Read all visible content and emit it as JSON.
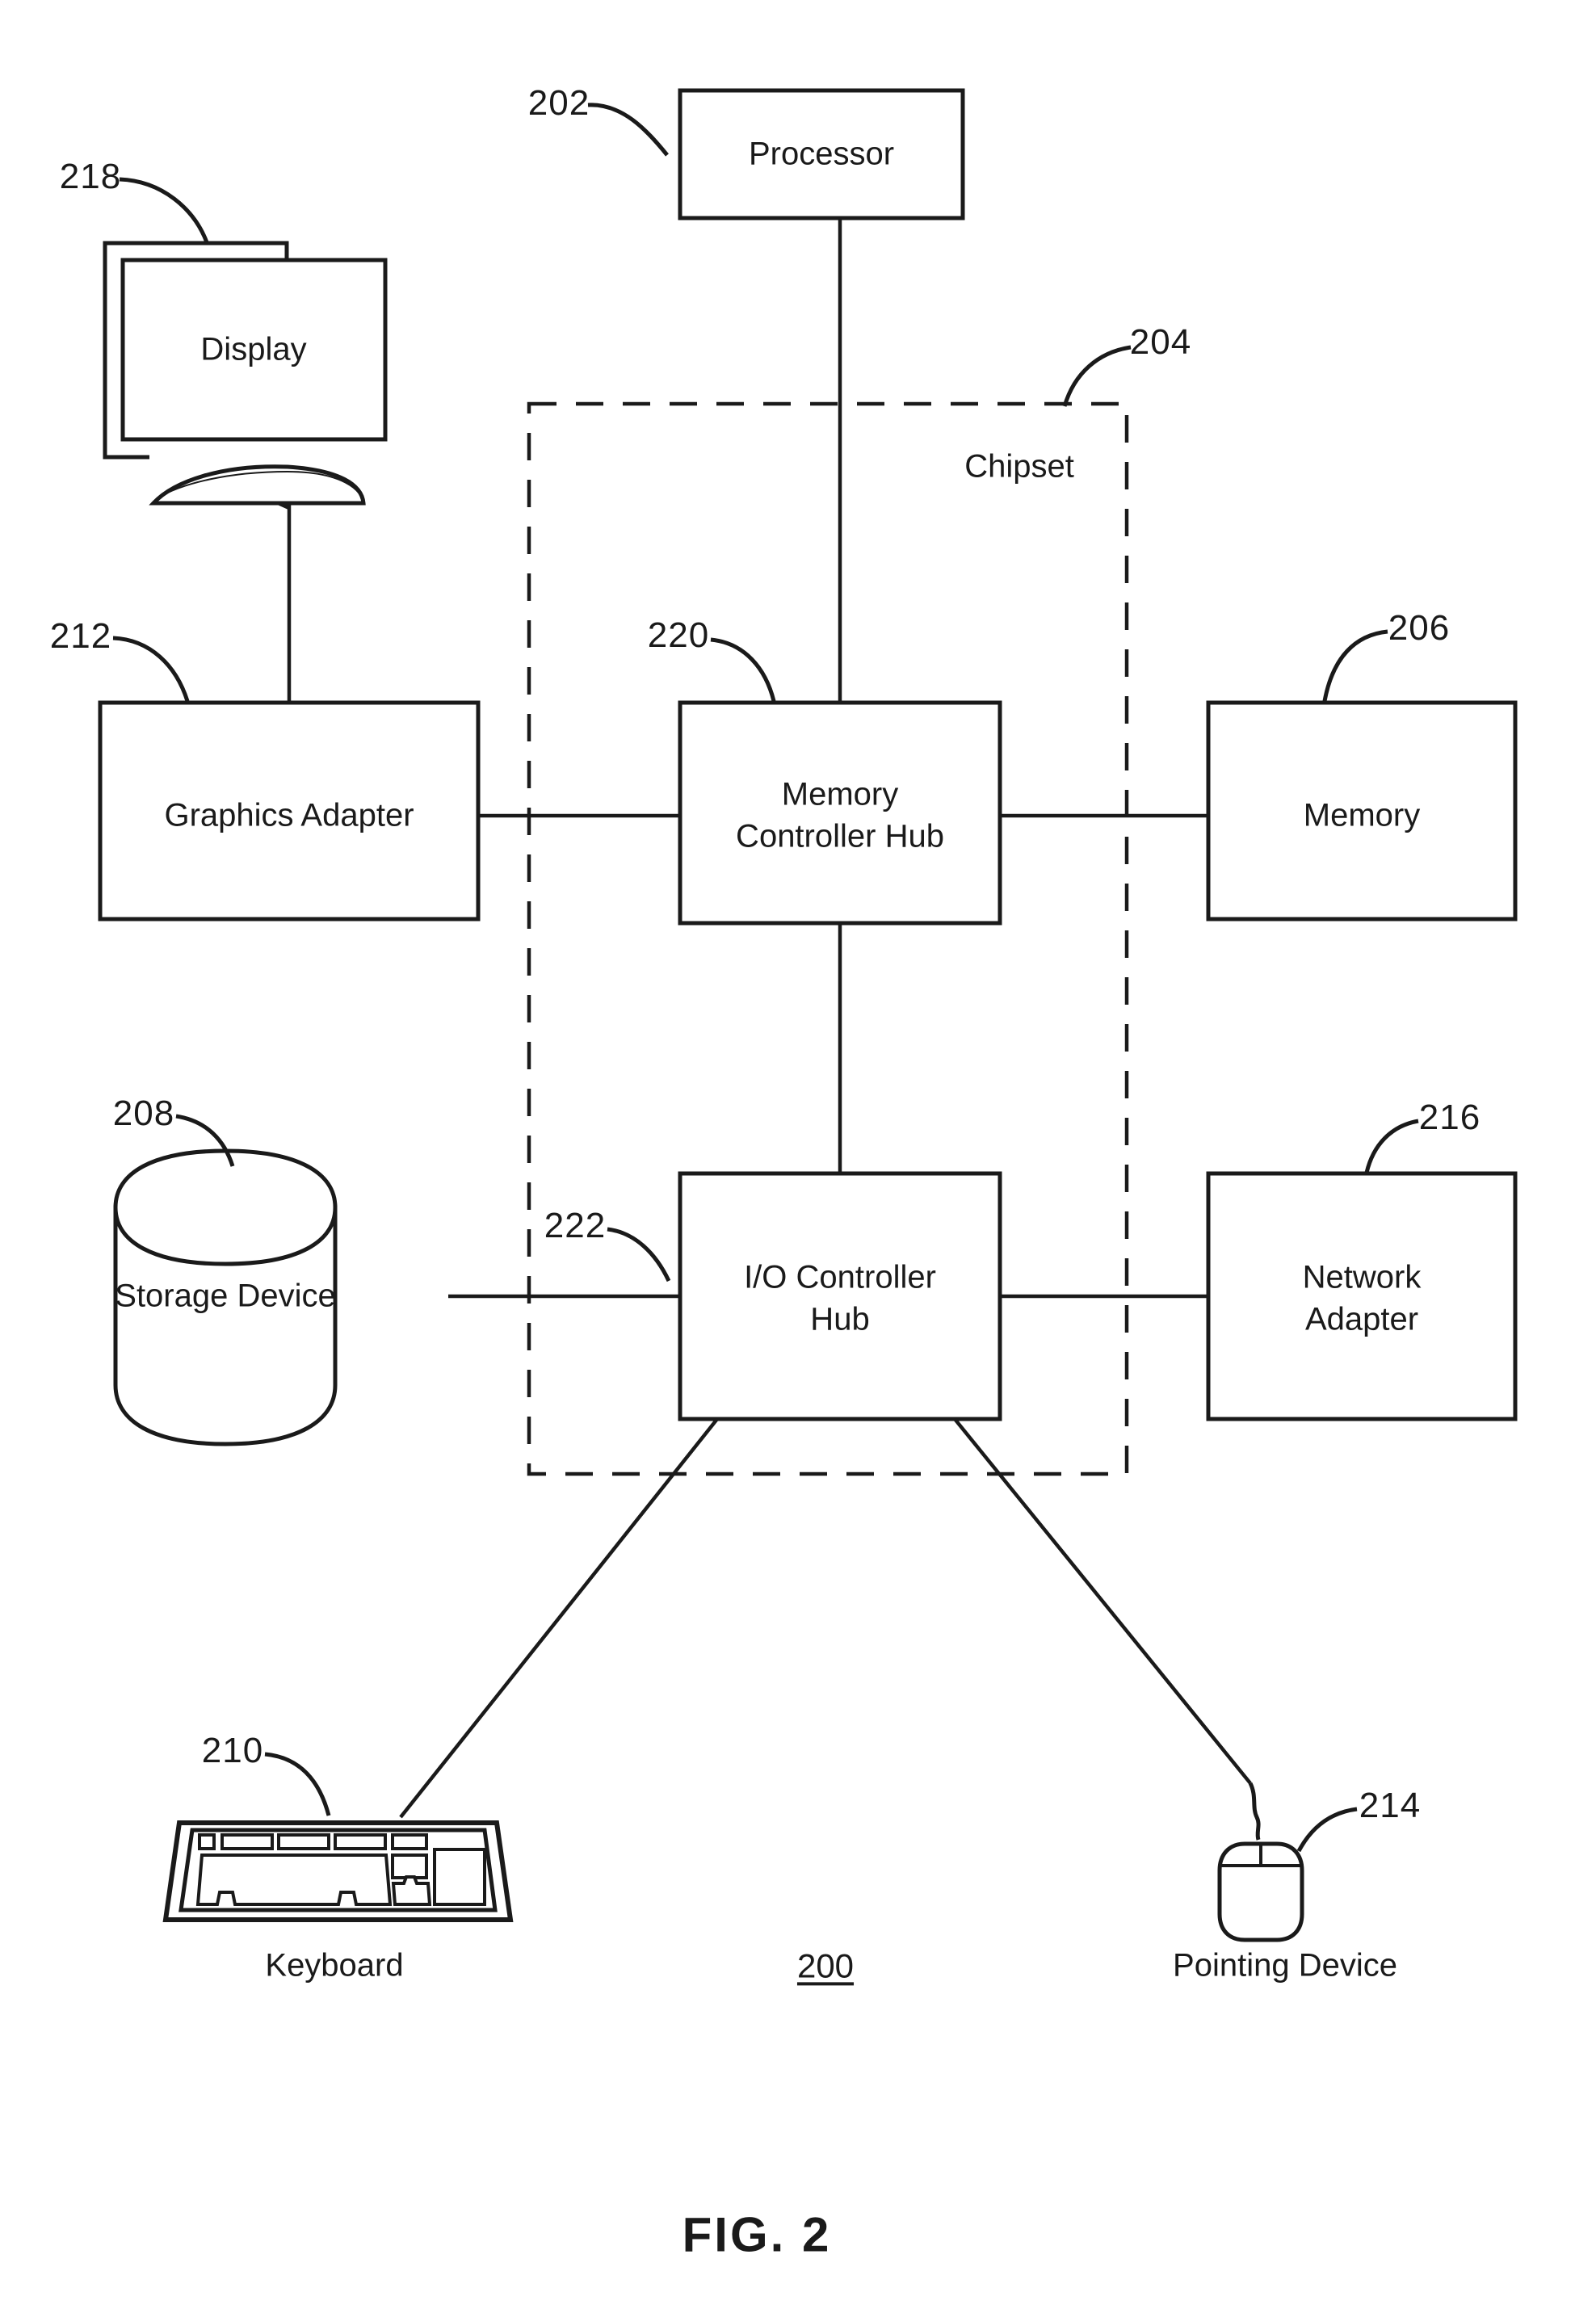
{
  "figure": {
    "caption": "FIG. 2",
    "system_number": "200",
    "chipset_label": "Chipset"
  },
  "blocks": [
    {
      "id": "processor",
      "label": "Processor",
      "ref": "202"
    },
    {
      "id": "chipset",
      "label": "Chipset",
      "ref": "204"
    },
    {
      "id": "memory",
      "label": "Memory",
      "ref": "206"
    },
    {
      "id": "storage_device",
      "label": "Storage Device",
      "ref": "208"
    },
    {
      "id": "keyboard",
      "label": "Keyboard",
      "ref": "210"
    },
    {
      "id": "graphics_adapter",
      "label": "Graphics Adapter",
      "ref": "212"
    },
    {
      "id": "pointing_device",
      "label": "Pointing Device",
      "ref": "214"
    },
    {
      "id": "network_adapter",
      "label": "Network\nAdapter",
      "ref": "216"
    },
    {
      "id": "display",
      "label": "Display",
      "ref": "218"
    },
    {
      "id": "memory_hub",
      "label": "Memory\nController Hub",
      "ref": "220"
    },
    {
      "id": "io_hub",
      "label": "I/O Controller\nHub",
      "ref": "222"
    }
  ],
  "labels": {
    "processor": "Processor",
    "display": "Display",
    "graphics_adapter": "Graphics Adapter",
    "memory_hub_line1": "Memory",
    "memory_hub_line2": "Controller Hub",
    "memory": "Memory",
    "storage_device": "Storage Device",
    "io_hub_line1": "I/O Controller",
    "io_hub_line2": "Hub",
    "network_adapter_line1": "Network",
    "network_adapter_line2": "Adapter",
    "keyboard": "Keyboard",
    "pointing_device": "Pointing Device"
  },
  "refs": {
    "processor": "202",
    "chipset": "204",
    "memory": "206",
    "storage_device": "208",
    "keyboard": "210",
    "graphics_adapter": "212",
    "pointing_device": "214",
    "network_adapter": "216",
    "display": "218",
    "memory_hub": "220",
    "io_hub": "222"
  },
  "style": {
    "line_color": "#1a1a1a",
    "background": "#ffffff"
  }
}
